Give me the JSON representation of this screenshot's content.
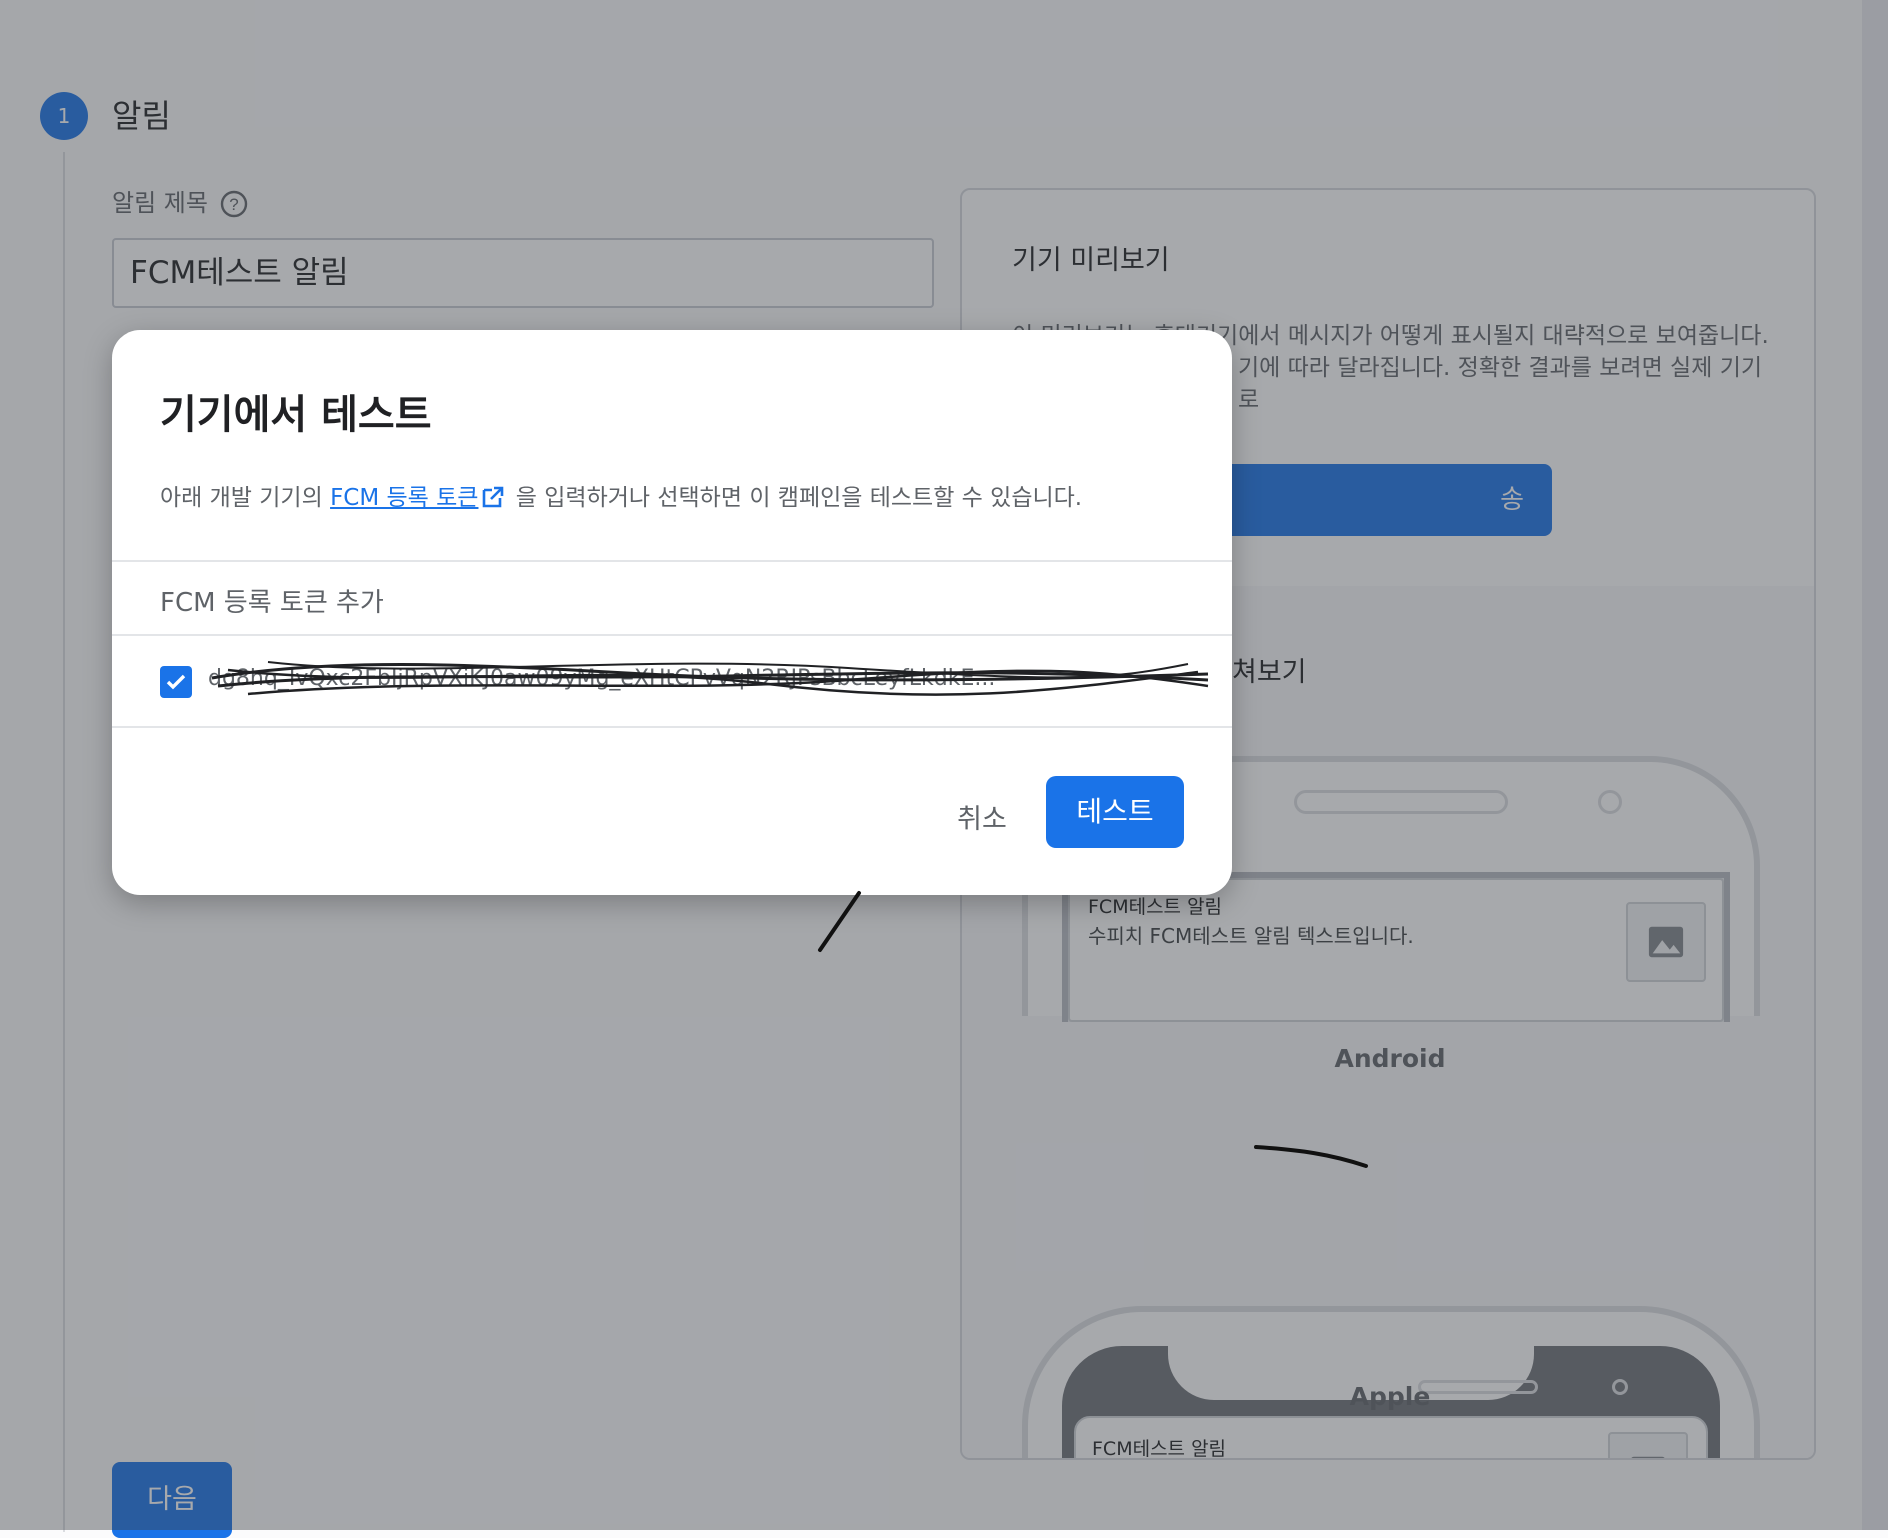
{
  "step": {
    "number": "1",
    "title": "알림"
  },
  "form": {
    "title_label": "알림 제목",
    "title_value": "FCM테스트 알림",
    "next_label": "다음"
  },
  "preview": {
    "title": "기기 미리보기",
    "description_line1": "이 미리보기는 휴대기기에서 메시지가 어떻게 표시될지 대략적으로 보여줍니다.",
    "description_line2": "기에 따라 달라집니다. 정확한 결과를 보려면 실제 기기로",
    "send_label": "송",
    "subheading_partial": "쳐보기",
    "notification_title": "FCM테스트 알림",
    "notification_body": "수피치 FCM테스트 알림 텍스트입니다.",
    "android_label": "Android",
    "apple_label": "Apple"
  },
  "dialog": {
    "title": "기기에서 테스트",
    "desc_before": "아래 개발 기기의 ",
    "desc_link": "FCM 등록 토큰",
    "desc_after": " 을 입력하거나 선택하면 이 캠페인을 테스트할 수 있습니다.",
    "token_placeholder": "FCM 등록 토큰 추가",
    "token_value": "dg8hq_IvQxc2FbIjRpVXiKJ0aw09yMg_eXHtCPvVqN2RJPsBbcLeyfLkdkE...",
    "token_checked": true,
    "cancel_label": "취소",
    "test_label": "테스트"
  },
  "colors": {
    "primary": "#1a73e8",
    "scrim": "rgba(60,64,72,0.45)"
  },
  "icons": {
    "help": "help-circle-icon",
    "external": "open-in-new-icon",
    "check": "check-icon",
    "image": "image-icon"
  }
}
